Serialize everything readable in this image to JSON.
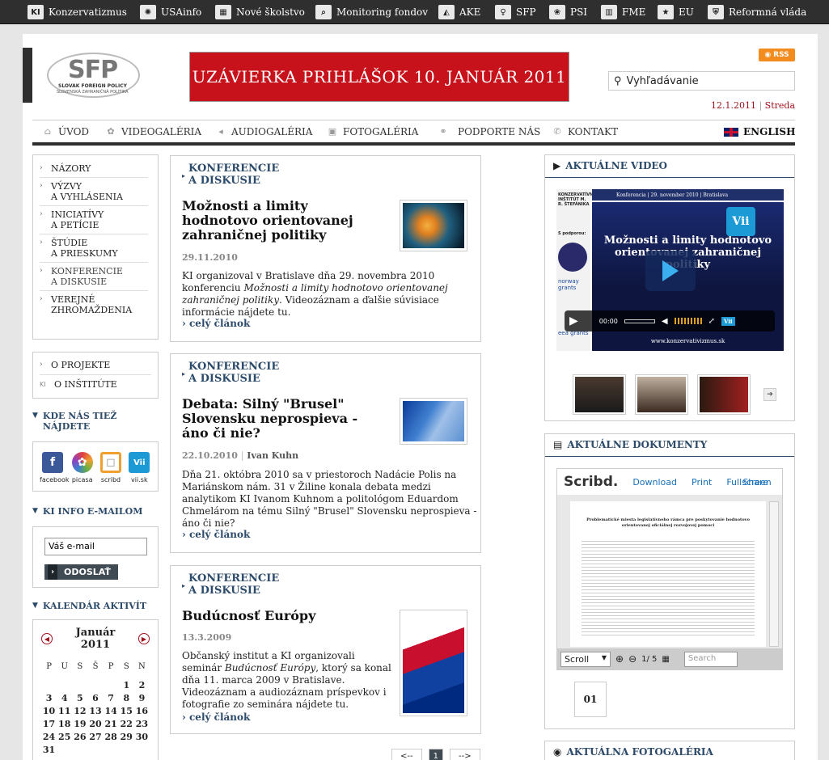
{
  "topbar": {
    "items": [
      {
        "icon": "KI",
        "label": "Konzervatizmus"
      },
      {
        "icon": "✺",
        "label": "USAinfo"
      },
      {
        "icon": "▦",
        "label": "Nové školstvo"
      },
      {
        "icon": "⌕",
        "label": "Monitoring fondov"
      },
      {
        "icon": "◭",
        "label": "AKE"
      },
      {
        "icon": "♀",
        "label": "SFP"
      },
      {
        "icon": "❀",
        "label": "PSI"
      },
      {
        "icon": "▥",
        "label": "FME"
      },
      {
        "icon": "★",
        "label": "EU"
      },
      {
        "icon": "⛨",
        "label": "Reformná vláda"
      }
    ]
  },
  "header": {
    "logo_text": "SFP",
    "logo_sub1": "SLOVAK FOREIGN POLICY",
    "logo_sub2": "SLOVENSKÁ ZAHRANIČNÁ POLITIKA",
    "banner": "UZÁVIERKA PRIHLÁŠOK 10. JANUÁR 2011",
    "rss": "RSS",
    "search_value": "Vyhľadávanie",
    "date": "12.1.2011",
    "day": "Streda"
  },
  "nav": {
    "items": [
      {
        "icon": "⌂",
        "label": "ÚVOD"
      },
      {
        "icon": "✿",
        "label": "VIDEOGALÉRIA"
      },
      {
        "icon": "◂",
        "label": "AUDIOGALÉRIA"
      },
      {
        "icon": "▣",
        "label": "FOTOGALÉRIA"
      },
      {
        "icon": "⚭",
        "label": "PODPORTE NÁS"
      },
      {
        "icon": "✆",
        "label": "KONTAKT"
      }
    ],
    "english": "ENGLISH"
  },
  "left_menu": [
    {
      "l1": "NÁZORY",
      "l2": ""
    },
    {
      "l1": "VÝZVY",
      "l2": "A VYHLÁSENIA"
    },
    {
      "l1": "INICIATÍVY",
      "l2": "A PETÍCIE"
    },
    {
      "l1": "ŠTÚDIE",
      "l2": "A PRIESKUMY"
    },
    {
      "l1": "KONFERENCIE",
      "l2": "A DISKUSIE"
    },
    {
      "l1": "VEREJNÉ",
      "l2": "ZHROMAŽDENIA"
    }
  ],
  "left_links": [
    {
      "icon": "›",
      "label": "O PROJEKTE"
    },
    {
      "icon": "KI",
      "label": "O INŠTITÚTE"
    }
  ],
  "where": {
    "title1": "KDE NÁS TIEŽ",
    "title2": "NÁJDETE",
    "items": [
      {
        "icon": "f",
        "label": "facebook",
        "color": "#3b5998"
      },
      {
        "icon": "✿",
        "label": "picasa",
        "color": "#e04040"
      },
      {
        "icon": "◻",
        "label": "scribd",
        "color": "#f0a030"
      },
      {
        "icon": "Vii",
        "label": "vii.sk",
        "color": "#1b9ad6"
      }
    ]
  },
  "newsletter": {
    "title": "KI INFO E-MAILOM",
    "placeholder": "Váš e-mail",
    "button": "ODOSLAŤ"
  },
  "calendar": {
    "title": "KALENDÁR AKTIVÍT",
    "month": "Január",
    "year": "2011",
    "days": [
      "P",
      "U",
      "S",
      "Š",
      "P",
      "S",
      "N"
    ],
    "cells": [
      "",
      "",
      "",
      "",
      "",
      "1",
      "2",
      "3",
      "4",
      "5",
      "6",
      "7",
      "8",
      "9",
      "10",
      "11",
      "12",
      "13",
      "14",
      "15",
      "16",
      "17",
      "18",
      "19",
      "20",
      "21",
      "22",
      "23",
      "24",
      "25",
      "26",
      "27",
      "28",
      "29",
      "30",
      "31"
    ]
  },
  "articles": [
    {
      "cat1": "KONFERENCIE",
      "cat2": "A DISKUSIE",
      "title": "Možnosti a limity hodnotovo orientovanej zahraničnej politiky",
      "date": "29.11.2010",
      "author": "",
      "body_1": "KI organizoval v Bratislave dňa 29. novembra 2010 konferenciu ",
      "body_em": "Možnosti a limity hodnotovo orientovanej zahraničnej politiky",
      "body_2": ". Videozáznam a ďalšie súvisiace informácie nájdete tu.",
      "more": "celý článok"
    },
    {
      "cat1": "KONFERENCIE",
      "cat2": "A DISKUSIE",
      "title": "Debata: Silný \"Brusel\" Slovensku neprospieva - áno či nie?",
      "date": "22.10.2010",
      "author": "Ivan Kuhn",
      "body_1": "Dňa 21. októbra 2010 sa v priestoroch Nadácie Polis na Mariánskom nám. 31 v Žiline konala debata medzi analytikom KI Ivanom Kuhnom a politológom Eduardom Chmelárom na tému Silný \"Brusel\" Slovensku neprospieva - áno či nie?",
      "body_em": "",
      "body_2": "",
      "more": "celý článok"
    },
    {
      "cat1": "KONFERENCIE",
      "cat2": "A DISKUSIE",
      "title": "Budúcnosť Európy",
      "date": "13.3.2009",
      "author": "",
      "body_1": "Občanský institut a KI organizovali seminár ",
      "body_em": "Budúcnosť Európy",
      "body_2": ", ktorý sa konal dňa 11. marca 2009 v Bratislave. Videozáznam a audiozáznam príspevkov i fotografie zo seminára nájdete tu.",
      "more": "celý článok"
    }
  ],
  "pager": {
    "prev": "<--",
    "current": "1",
    "next": "-->"
  },
  "video": {
    "title": "AKTUÁLNE VIDEO",
    "top": "Konferencia  |  29. november 2010  |  Bratislava",
    "headline": "Možnosti a limity hodnotovo orientovanej zahraničnej politiky",
    "time": "00:00",
    "url": "www.konzervativizmus.sk",
    "left_text": "KONZERVATÍVNY INŠTITÚT M. R. ŠTEFÁNIKA",
    "support": "S podporou:",
    "norway": "norway grants",
    "eea": "eea grants",
    "vii": "Vii"
  },
  "docs": {
    "title": "AKTUÁLNE DOKUMENTY",
    "brand": "Scribd.",
    "download": "Download",
    "print": "Print",
    "fullscreen": "Fullscreen",
    "share": "Share",
    "doc_title": "Problematické miesta legislatívneho rámca pre poskytovanie hodnotovo orientovanej oficiálnej rozvojovej pomoci",
    "scroll": "Scroll",
    "page": "1",
    "pages": "/ 5",
    "search_ph": "Search",
    "badge": "01"
  },
  "foto": {
    "title": "AKTUÁLNA FOTOGALÉRIA"
  }
}
